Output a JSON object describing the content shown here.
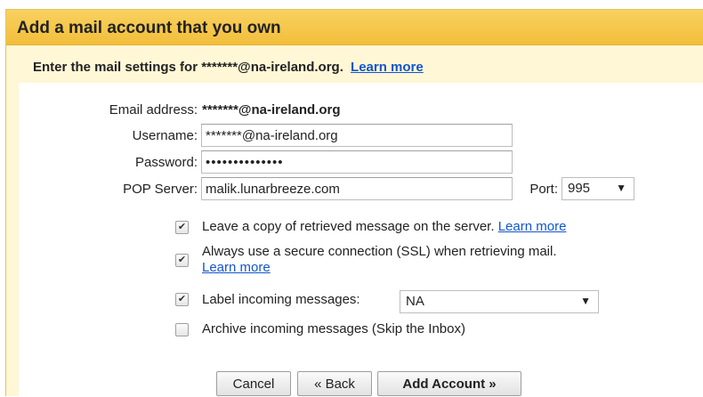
{
  "dialog": {
    "title": "Add a mail account that you own",
    "intro_text": "Enter the mail settings for *******@na-ireland.org.",
    "intro_link": "Learn more"
  },
  "form": {
    "email_label": "Email address:",
    "email_value": "*******@na-ireland.org",
    "username_label": "Username:",
    "username_value": "*******@na-ireland.org",
    "password_label": "Password:",
    "password_value": "••••••••••••••",
    "pop_label": "POP Server:",
    "pop_value": "malik.lunarbreeze.com",
    "port_label": "Port:",
    "port_value": "995"
  },
  "options": {
    "leave_copy": {
      "label": "Leave a copy of retrieved message on the server.",
      "link": "Learn more",
      "checked": true
    },
    "ssl": {
      "label": "Always use a secure connection (SSL) when retrieving mail.",
      "link": "Learn more",
      "checked": true
    },
    "label_incoming": {
      "label": "Label incoming messages:",
      "value": "NA",
      "checked": true
    },
    "archive": {
      "label": "Archive incoming messages (Skip the Inbox)",
      "checked": false
    }
  },
  "buttons": {
    "cancel": "Cancel",
    "back": "« Back",
    "add": "Add Account »"
  },
  "icons": {
    "check": "✔",
    "dropdown": "▼"
  },
  "colors": {
    "header_bg": "#f2be3b",
    "panel_bg": "#fff7d6",
    "link": "#1155cc"
  }
}
